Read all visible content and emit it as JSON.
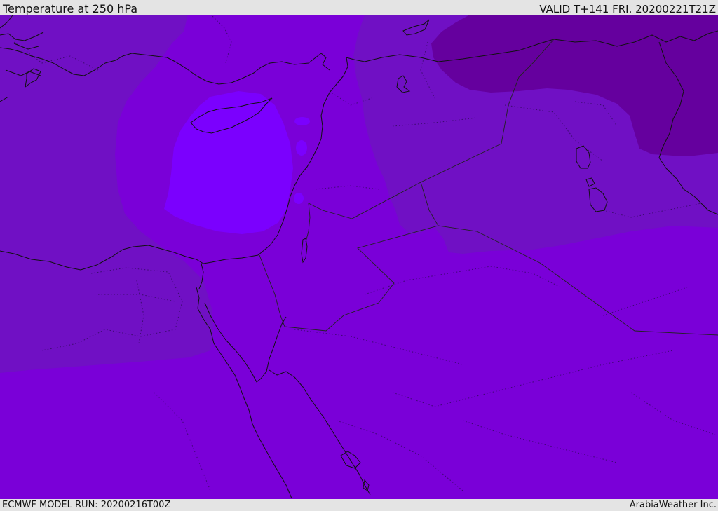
{
  "header": {
    "title": "Temperature at 250 hPa",
    "valid": "VALID T+141 FRI. 20200221T21Z"
  },
  "footer": {
    "model_run": "ECMWF MODEL RUN: 20200216T00Z",
    "credit": "ArabiaWeather Inc."
  },
  "map": {
    "field": "temperature",
    "colors": {
      "base": "#7a00d8",
      "warmest_core": "#7b00fe",
      "warm": "#7b02e6",
      "cool": "#7010c4",
      "cold": "#65009e"
    }
  }
}
